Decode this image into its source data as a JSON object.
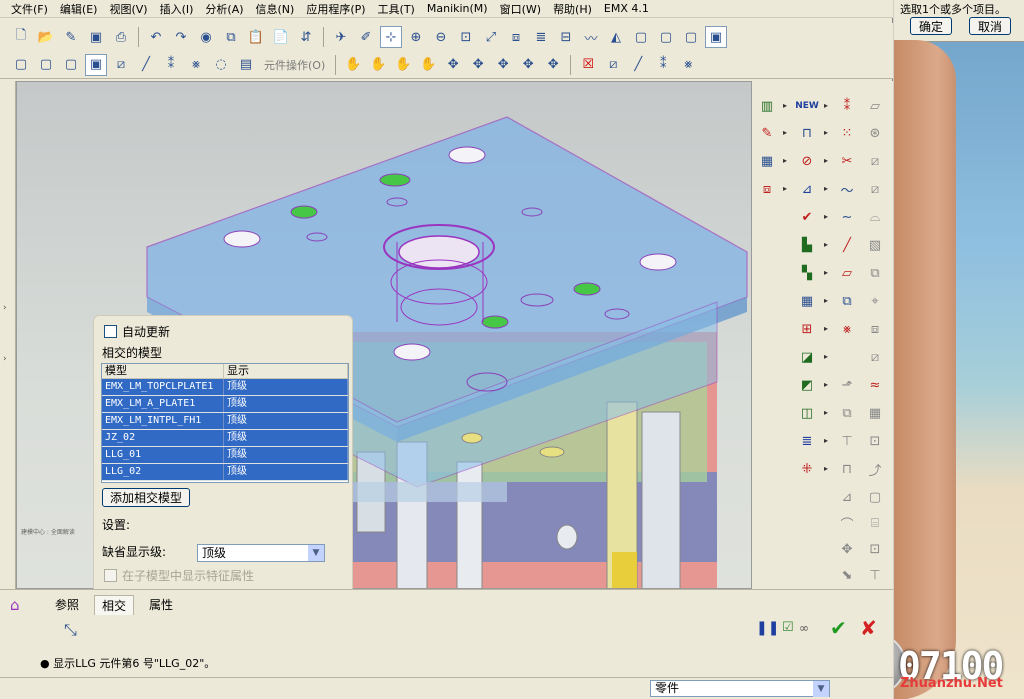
{
  "menubar": {
    "items": [
      "文件(F)",
      "编辑(E)",
      "视图(V)",
      "插入(I)",
      "分析(A)",
      "信息(N)",
      "应用程序(P)",
      "工具(T)",
      "Manikin(M)",
      "窗口(W)",
      "帮助(H)",
      "EMX 4.1"
    ]
  },
  "toolbar2": {
    "component_ops_label": "元件操作(O)"
  },
  "panel": {
    "auto_update_label": "自动更新",
    "intersected_models_label": "相交的模型",
    "table": {
      "headers": [
        "模型",
        "显示"
      ],
      "rows": [
        [
          "EMX_LM_TOPCLPLATE1",
          "顶级"
        ],
        [
          "EMX_LM_A_PLATE1",
          "顶级"
        ],
        [
          "EMX_LM_INTPL_FH1",
          "顶级"
        ],
        [
          "JZ_02",
          "顶级"
        ],
        [
          "LLG_01",
          "顶级"
        ],
        [
          "LLG_02",
          "顶级"
        ]
      ]
    },
    "add_button_label": "添加相交模型",
    "settings_label": "设置:",
    "default_level_label": "缺省显示级:",
    "default_level_value": "顶级",
    "show_features_label": "在子模型中显示特征属性"
  },
  "dashboard": {
    "tabs": [
      "参照",
      "相交",
      "属性"
    ],
    "active_tab": "相交",
    "status_message": "● 显示LLG 元件第6 号\"LLG_02\"。"
  },
  "status_bar": {
    "filter_value": "零件"
  },
  "selection_prompt": {
    "text": "选取1个或多个项目。",
    "ok_label": "确定",
    "cancel_label": "取消"
  },
  "watermark": {
    "logo_number": "07100",
    "site": "Zhuanzhu.Net"
  },
  "viewport_annotation": "建模中心 : 全面解读"
}
